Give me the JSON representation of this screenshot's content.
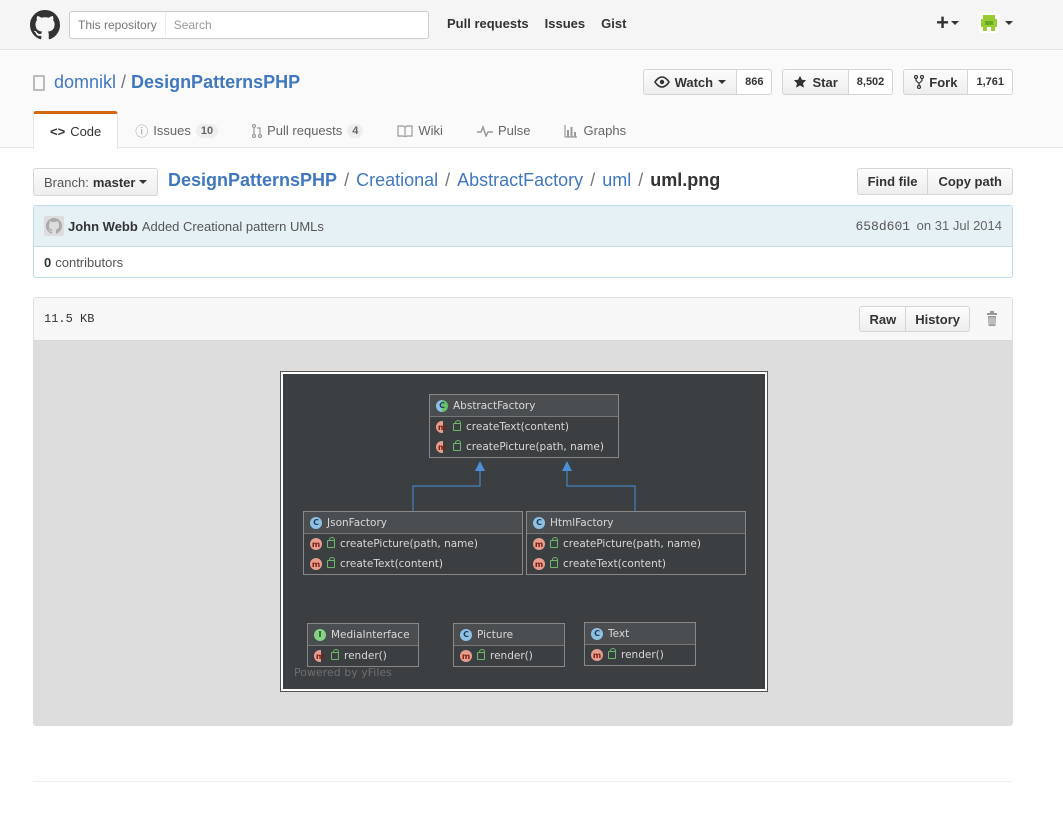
{
  "header": {
    "search_scope": "This repository",
    "search_placeholder": "Search",
    "nav": [
      "Pull requests",
      "Issues",
      "Gist"
    ],
    "new_menu": "+"
  },
  "repo": {
    "owner": "domnikl",
    "separator": "/",
    "name": "DesignPatternsPHP",
    "actions": {
      "watch_label": "Watch",
      "watch_count": "866",
      "star_label": "Star",
      "star_count": "8,502",
      "fork_label": "Fork",
      "fork_count": "1,761"
    },
    "tabs": [
      {
        "label": "Code",
        "selected": true
      },
      {
        "label": "Issues",
        "count": "10"
      },
      {
        "label": "Pull requests",
        "count": "4"
      },
      {
        "label": "Wiki"
      },
      {
        "label": "Pulse"
      },
      {
        "label": "Graphs"
      }
    ]
  },
  "file_nav": {
    "branch_prefix": "Branch:",
    "branch": "master",
    "breadcrumb": [
      "DesignPatternsPHP",
      "Creational",
      "AbstractFactory",
      "uml"
    ],
    "filename": "uml.png",
    "find_file": "Find file",
    "copy_path": "Copy path"
  },
  "commit": {
    "author": "John Webb",
    "message": "Added Creational pattern UMLs",
    "sha": "658d601",
    "date_prefix": "on",
    "date": "31 Jul 2014",
    "contributors_count": "0",
    "contributors_label": "contributors"
  },
  "file": {
    "size": "11.5 KB",
    "raw": "Raw",
    "history": "History"
  },
  "uml": {
    "abstract_factory": {
      "name": "AbstractFactory",
      "icon": "C",
      "methods": [
        "createText(content)",
        "createPicture(path, name)"
      ]
    },
    "json_factory": {
      "name": "JsonFactory",
      "icon": "C",
      "methods": [
        "createPicture(path, name)",
        "createText(content)"
      ]
    },
    "html_factory": {
      "name": "HtmlFactory",
      "icon": "C",
      "methods": [
        "createPicture(path, name)",
        "createText(content)"
      ]
    },
    "media_interface": {
      "name": "MediaInterface",
      "icon": "I",
      "methods": [
        "render()"
      ]
    },
    "picture": {
      "name": "Picture",
      "icon": "C",
      "methods": [
        "render()"
      ]
    },
    "text": {
      "name": "Text",
      "icon": "C",
      "methods": [
        "render()"
      ]
    },
    "method_icon": "m",
    "watermark": "Powered by yFiles"
  },
  "colors": {
    "link": "#4078c0",
    "tab_accent": "#d26911",
    "uml_bg": "#3c3f41",
    "arrow": "#4a90d9"
  }
}
